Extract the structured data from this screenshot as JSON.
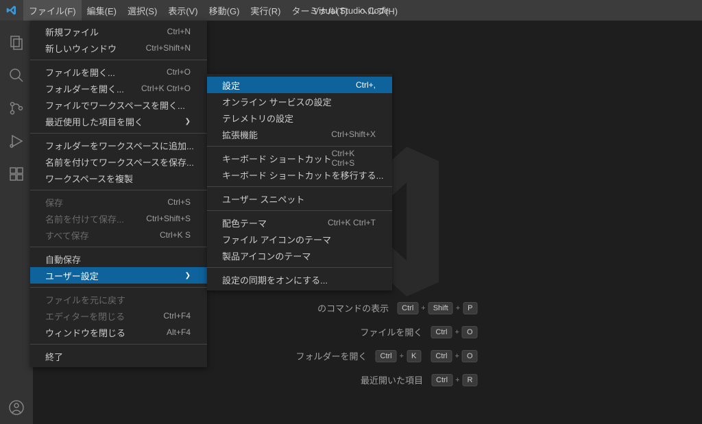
{
  "title": "Visual Studio Code",
  "menubar": [
    "ファイル(F)",
    "編集(E)",
    "選択(S)",
    "表示(V)",
    "移動(G)",
    "実行(R)",
    "ターミナル(T)",
    "ヘルプ(H)"
  ],
  "fileMenu": {
    "groups": [
      [
        {
          "label": "新規ファイル",
          "shortcut": "Ctrl+N"
        },
        {
          "label": "新しいウィンドウ",
          "shortcut": "Ctrl+Shift+N"
        }
      ],
      [
        {
          "label": "ファイルを開く...",
          "shortcut": "Ctrl+O"
        },
        {
          "label": "フォルダーを開く...",
          "shortcut": "Ctrl+K Ctrl+O"
        },
        {
          "label": "ファイルでワークスペースを開く..."
        },
        {
          "label": "最近使用した項目を開く",
          "submenu": true
        }
      ],
      [
        {
          "label": "フォルダーをワークスペースに追加..."
        },
        {
          "label": "名前を付けてワークスペースを保存..."
        },
        {
          "label": "ワークスペースを複製"
        }
      ],
      [
        {
          "label": "保存",
          "shortcut": "Ctrl+S",
          "disabled": true
        },
        {
          "label": "名前を付けて保存...",
          "shortcut": "Ctrl+Shift+S",
          "disabled": true
        },
        {
          "label": "すべて保存",
          "shortcut": "Ctrl+K S",
          "disabled": true
        }
      ],
      [
        {
          "label": "自動保存"
        },
        {
          "label": "ユーザー設定",
          "submenu": true,
          "highlighted": true
        }
      ],
      [
        {
          "label": "ファイルを元に戻す",
          "disabled": true
        },
        {
          "label": "エディターを閉じる",
          "shortcut": "Ctrl+F4",
          "disabled": true
        },
        {
          "label": "ウィンドウを閉じる",
          "shortcut": "Alt+F4"
        }
      ],
      [
        {
          "label": "終了"
        }
      ]
    ]
  },
  "prefsSubmenu": {
    "groups": [
      [
        {
          "label": "設定",
          "shortcut": "Ctrl+,",
          "highlighted": true
        },
        {
          "label": "オンライン サービスの設定"
        },
        {
          "label": "テレメトリの設定"
        },
        {
          "label": "拡張機能",
          "shortcut": "Ctrl+Shift+X"
        }
      ],
      [
        {
          "label": "キーボード ショートカット",
          "shortcut": "Ctrl+K Ctrl+S"
        },
        {
          "label": "キーボード ショートカットを移行する..."
        }
      ],
      [
        {
          "label": "ユーザー スニペット"
        }
      ],
      [
        {
          "label": "配色テーマ",
          "shortcut": "Ctrl+K Ctrl+T"
        },
        {
          "label": "ファイル アイコンのテーマ"
        },
        {
          "label": "製品アイコンのテーマ"
        }
      ],
      [
        {
          "label": "設定の同期をオンにする..."
        }
      ]
    ]
  },
  "hints": [
    {
      "label": "のコマンドの表示",
      "keys": [
        "Ctrl",
        "Shift",
        "P"
      ]
    },
    {
      "label": "ファイルを開く",
      "keys": [
        "Ctrl",
        "O"
      ]
    },
    {
      "label": "フォルダーを開く",
      "keys": [
        "Ctrl",
        "K",
        "|",
        "Ctrl",
        "O"
      ]
    },
    {
      "label": "最近開いた項目",
      "keys": [
        "Ctrl",
        "R"
      ]
    }
  ]
}
